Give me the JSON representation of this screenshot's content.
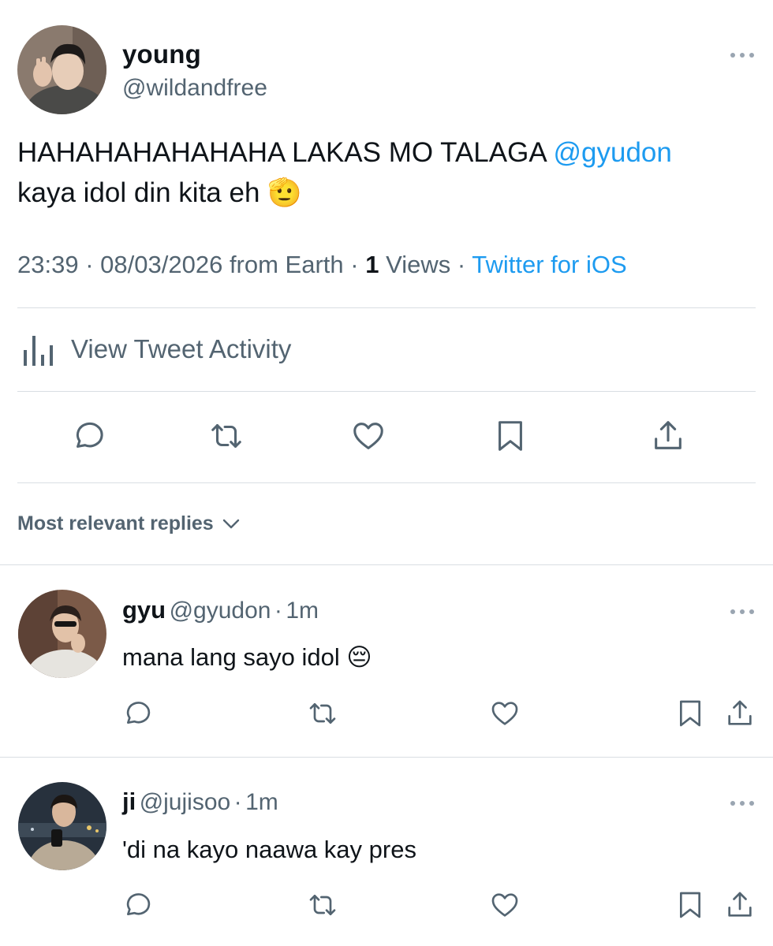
{
  "tweet": {
    "author_name": "young",
    "author_handle": "@wildandfree",
    "text_before_mention": "HAHAHAHAHAHAHA LAKAS MO TALAGA ",
    "mention": "@gyudon",
    "text_after_mention": "kaya idol din kita eh",
    "emoji": "🫡",
    "time": "23:39",
    "date": "08/03/2026",
    "location": "from Earth",
    "views_count": "1",
    "views_label": "Views",
    "source": "Twitter for iOS",
    "separator": "·"
  },
  "activity": {
    "label": "View Tweet Activity",
    "icon": "bar-chart-icon"
  },
  "actions": [
    "reply-icon",
    "retweet-icon",
    "like-icon",
    "bookmark-icon",
    "share-icon"
  ],
  "replies_sort": {
    "label": "Most relevant replies",
    "icon": "chevron-down-icon"
  },
  "replies": [
    {
      "name": "gyu",
      "handle": "@gyudon",
      "age": "1m",
      "text": "mana lang sayo idol",
      "emoji": "😔"
    },
    {
      "name": "ji",
      "handle": "@jujisoo",
      "age": "1m",
      "text": "'di na kayo naawa kay pres",
      "emoji": ""
    }
  ],
  "colors": {
    "accent": "#1d9bf0",
    "secondary_text": "#536471",
    "primary_text": "#0f1419",
    "divider": "#d9dee3"
  }
}
